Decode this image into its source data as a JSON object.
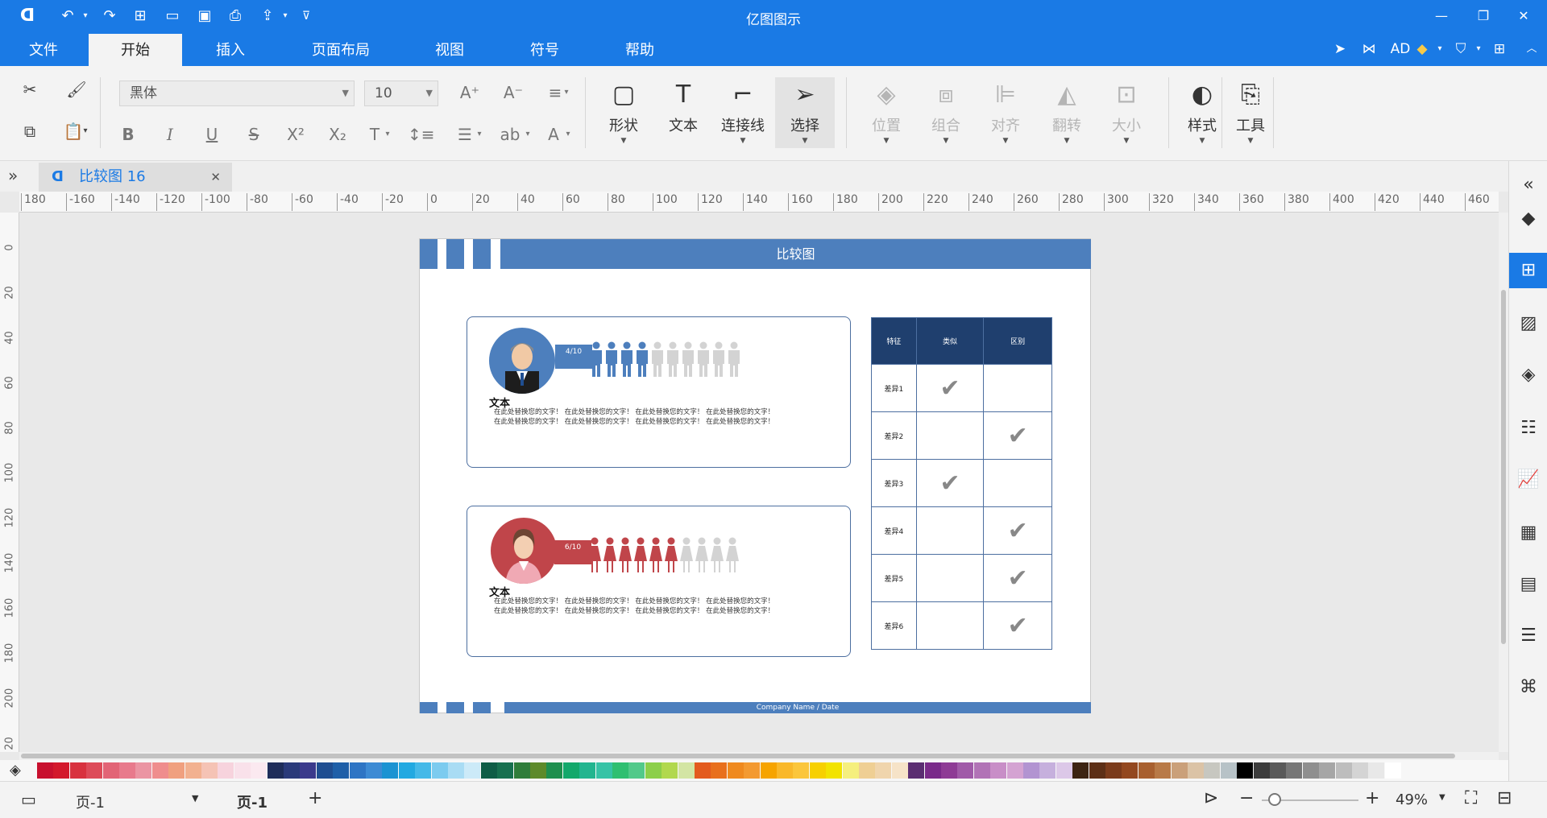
{
  "app": {
    "title": "亿图图示"
  },
  "menu": {
    "tabs": [
      "文件",
      "开始",
      "插入",
      "页面布局",
      "视图",
      "符号",
      "帮助"
    ],
    "active": "开始",
    "user": "AD"
  },
  "ribbon": {
    "font_name": "黑体",
    "font_size": "10",
    "big_buttons": [
      "形状",
      "文本",
      "连接线",
      "选择"
    ],
    "arrange_buttons": [
      "位置",
      "组合",
      "对齐",
      "翻转",
      "大小"
    ],
    "style_buttons": [
      "样式",
      "工具"
    ]
  },
  "document_tab": {
    "label": "比较图 16"
  },
  "rulers": {
    "horizontal": [
      "180",
      "-160",
      "-140",
      "-120",
      "-100",
      "-80",
      "-60",
      "-40",
      "-20",
      "0",
      "20",
      "40",
      "60",
      "80",
      "100",
      "120",
      "140",
      "160",
      "180",
      "200",
      "220",
      "240",
      "260",
      "280",
      "300",
      "320",
      "340",
      "360",
      "380",
      "400",
      "420",
      "440",
      "460"
    ],
    "vertical": [
      "0",
      "20",
      "40",
      "60",
      "80",
      "100",
      "120",
      "140",
      "160",
      "180",
      "200",
      "20"
    ]
  },
  "diagram": {
    "title": "比较图",
    "footer": "Company Name / Date",
    "card1": {
      "ratio": "4/10",
      "filled": 4,
      "total": 10,
      "heading": "文本",
      "line1": "在此处替换您的文字！ 在此处替换您的文字！ 在此处替换您的文字！ 在此处替换您的文字！",
      "line2": "在此处替换您的文字！ 在此处替换您的文字！ 在此处替换您的文字！ 在此处替换您的文字！",
      "color": "#4d7fbd"
    },
    "card2": {
      "ratio": "6/10",
      "filled": 6,
      "total": 10,
      "heading": "文本",
      "line1": "在此处替换您的文字！ 在此处替换您的文字！ 在此处替换您的文字！ 在此处替换您的文字！",
      "line2": "在此处替换您的文字！ 在此处替换您的文字！ 在此处替换您的文字！ 在此处替换您的文字！",
      "color": "#c0454a"
    },
    "table": {
      "headers": [
        "特征",
        "类似",
        "区别"
      ],
      "rows": [
        {
          "label": "差异1",
          "similar": true,
          "different": false
        },
        {
          "label": "差异2",
          "similar": false,
          "different": true
        },
        {
          "label": "差异3",
          "similar": true,
          "different": false
        },
        {
          "label": "差异4",
          "similar": false,
          "different": true
        },
        {
          "label": "差异5",
          "similar": false,
          "different": true
        },
        {
          "label": "差异6",
          "similar": false,
          "different": true
        }
      ],
      "check_glyph": "✔"
    }
  },
  "status": {
    "page_selector": "页-1",
    "page_tab": "页-1",
    "zoom": "49%"
  },
  "colors": {
    "accent": "#1a7ae5",
    "diagram_blue": "#4d7fbd",
    "diagram_red": "#c0454a",
    "table_header": "#1f3f6e"
  },
  "palette": [
    "#c8102e",
    "#d3182c",
    "#d8323f",
    "#dd4b59",
    "#e26476",
    "#e87a8c",
    "#eb95a3",
    "#ef8d8d",
    "#f0a07f",
    "#f2b190",
    "#f5c3b5",
    "#f7d3dd",
    "#f9e1ea",
    "#fbe9f0",
    "#1f2d5a",
    "#2a3a7a",
    "#3b3a8c",
    "#1f4e91",
    "#1e5fa8",
    "#2e75c4",
    "#3d8bd4",
    "#1b93d2",
    "#22a9e1",
    "#45b9e8",
    "#7ccbef",
    "#a9dcf4",
    "#cceaf8",
    "#0f5d46",
    "#17704f",
    "#2f7d3a",
    "#5d8a2a",
    "#1e8f4e",
    "#13a86b",
    "#22b58f",
    "#37c3a6",
    "#2fbf71",
    "#52c98a",
    "#8ccf4a",
    "#b1d84e",
    "#d3e5a4",
    "#e35b1e",
    "#e8701c",
    "#ef8a1f",
    "#f39a31",
    "#f6a400",
    "#f9b82a",
    "#fbc63b",
    "#f7d000",
    "#f2e300",
    "#f5ef7e",
    "#efcf94",
    "#f0d5ad",
    "#f6e3c8",
    "#5b2d72",
    "#7a2a8a",
    "#8e3b95",
    "#a05aa8",
    "#b173b6",
    "#c88ec7",
    "#d4a3d2",
    "#b294d1",
    "#c6b0dd",
    "#dcc8e8",
    "#3d2412",
    "#5d2f16",
    "#7b3b1b",
    "#93481f",
    "#a8602f",
    "#b87a47",
    "#caa07a",
    "#dbc3a6",
    "#c7c7c0",
    "#b7c2c7",
    "#000000",
    "#3c3c3c",
    "#5a5a5a",
    "#777777",
    "#8f8f8f",
    "#a6a6a6",
    "#bdbdbd",
    "#d4d4d4",
    "#e8e8e8",
    "#ffffff"
  ]
}
